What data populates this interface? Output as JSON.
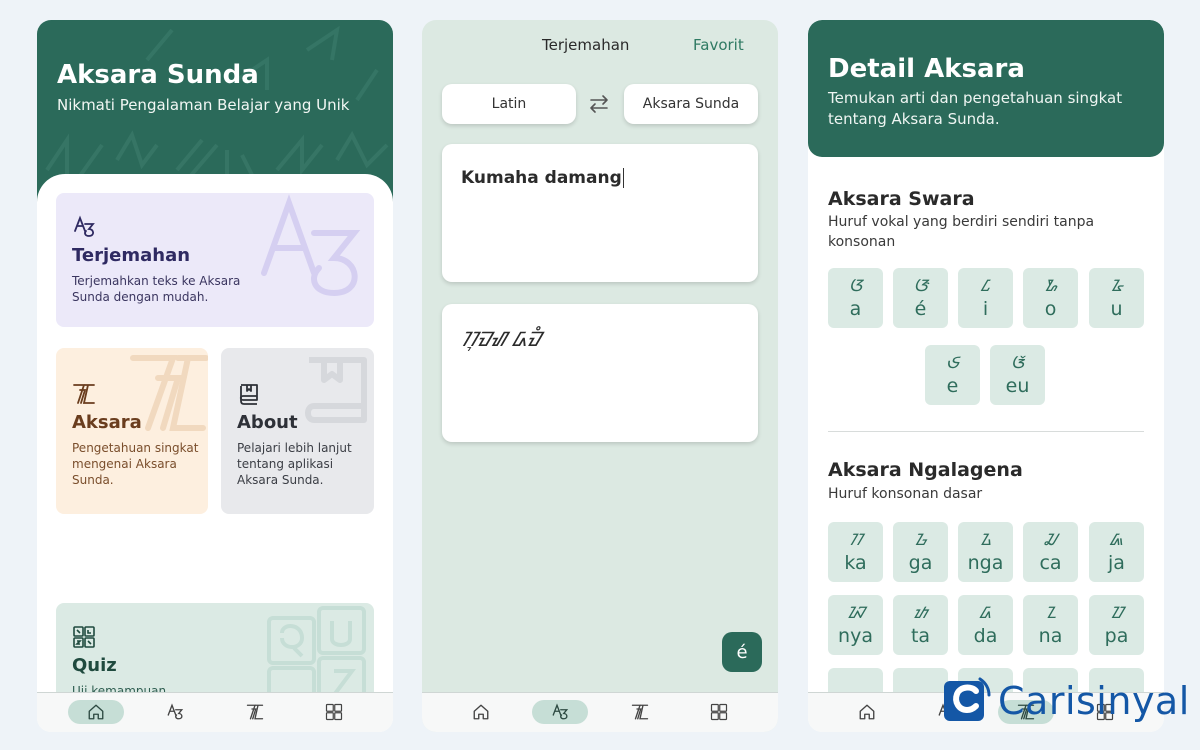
{
  "home": {
    "title": "Aksara Sunda",
    "subtitle": "Nikmati Pengalaman Belajar yang Unik",
    "cards": {
      "terjemahan": {
        "title": "Terjemahan",
        "desc": "Terjemahkan teks ke Aksara Sunda dengan mudah.",
        "icon": "translate-icon"
      },
      "aksara": {
        "title": "Aksara",
        "desc": "Pengetahuan singkat mengenai Aksara Sunda.",
        "icon": "aksara-icon"
      },
      "about": {
        "title": "About",
        "desc": "Pelajari lebih lanjut tentang aplikasi Aksara Sunda.",
        "icon": "book-icon"
      },
      "quiz": {
        "title": "Quiz",
        "desc": "Uji kemampuan",
        "icon": "quiz-icon"
      }
    },
    "navbar": {
      "active": "home",
      "items": [
        "home-icon",
        "translate-icon",
        "aksara-icon",
        "quiz-icon"
      ]
    }
  },
  "translate": {
    "tabs": {
      "terjemahan": "Terjemahan",
      "favorit": "Favorit"
    },
    "from_lang": "Latin",
    "to_lang": "Aksara Sunda",
    "input_text": "Kumaha damang",
    "output_text": "ᮊᮥᮙᮠ ᮓᮙᮀ",
    "accent_button": "é",
    "navbar": {
      "active": "translate"
    }
  },
  "detail": {
    "title": "Detail Aksara",
    "subtitle": "Temukan arti dan pengetahuan singkat tentang Aksara Sunda.",
    "swara": {
      "title": "Aksara Swara",
      "desc": "Huruf vokal yang berdiri sendiri tanpa konsonan",
      "chars": [
        {
          "glyph": "ᮃ",
          "latin": "a"
        },
        {
          "glyph": "ᮆ",
          "latin": "é"
        },
        {
          "glyph": "ᮄ",
          "latin": "i"
        },
        {
          "glyph": "ᮇ",
          "latin": "o"
        },
        {
          "glyph": "ᮅ",
          "latin": "u"
        },
        {
          "glyph": "ᮈ",
          "latin": "e"
        },
        {
          "glyph": "ᮉ",
          "latin": "eu"
        }
      ]
    },
    "ngalagena": {
      "title": "Aksara Ngalagena",
      "desc": "Huruf konsonan dasar",
      "chars": [
        {
          "glyph": "ᮊ",
          "latin": "ka"
        },
        {
          "glyph": "ᮌ",
          "latin": "ga"
        },
        {
          "glyph": "ᮍ",
          "latin": "nga"
        },
        {
          "glyph": "ᮎ",
          "latin": "ca"
        },
        {
          "glyph": "ᮏ",
          "latin": "ja"
        },
        {
          "glyph": "ᮑ",
          "latin": "nya"
        },
        {
          "glyph": "ᮒ",
          "latin": "ta"
        },
        {
          "glyph": "ᮓ",
          "latin": "da"
        },
        {
          "glyph": "ᮔ",
          "latin": "na"
        },
        {
          "glyph": "ᮕ",
          "latin": "pa"
        }
      ]
    },
    "navbar": {
      "active": "aksara"
    }
  },
  "watermark": {
    "text": "Carisinyal"
  },
  "colors": {
    "brand_green": "#2b6a5a",
    "tile_green": "#dbeae4",
    "accent_text_green": "#2f7a63",
    "card_purple": "#ece9f9",
    "card_orange": "#fdefdf",
    "card_gray": "#e8e9ec",
    "watermark_blue": "#1457a6"
  }
}
